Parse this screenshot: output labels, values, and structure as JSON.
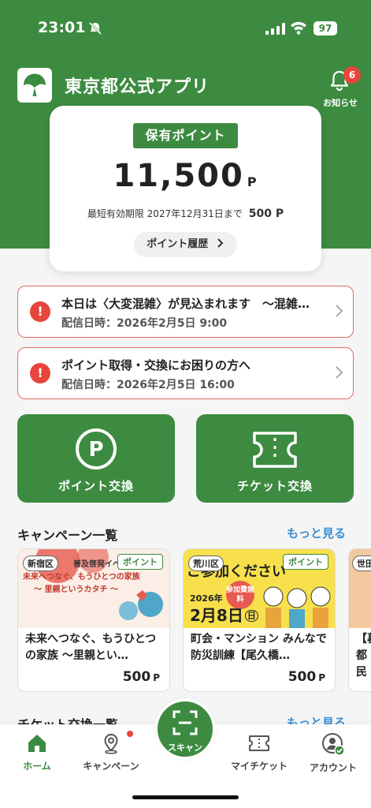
{
  "status": {
    "time": "23:01",
    "battery": "97"
  },
  "header": {
    "title": "東京都公式アプリ",
    "notice_label": "お知らせ",
    "notice_count": "6"
  },
  "points": {
    "tag": "保有ポイント",
    "value": "11,500",
    "unit": "P",
    "expiry_label": "最短有効期限 2027年12月31日まで",
    "expiry_amount": "500 P",
    "history_button": "ポイント履歴"
  },
  "alerts": [
    {
      "title": "本日は〈大変混雑〉が見込まれます　～混雑…",
      "date": "配信日時：2026年2月5日 9:00"
    },
    {
      "title": "ポイント取得・交換にお困りの方へ",
      "date": "配信日時：2026年2月5日 16:00"
    }
  ],
  "actions": {
    "point_exchange": "ポイント交換",
    "ticket_exchange": "チケット交換"
  },
  "campaigns": {
    "section_title": "キャンペーン一覧",
    "more": "もっと見る",
    "items": [
      {
        "ward": "新宿区",
        "tag": "ポイント",
        "banner_top": "普及啓発イベント",
        "banner_main": "未来へつなぐ、もうひとつの家族",
        "banner_sub": "～ 里親というカタチ ～",
        "title": "未来へつなぐ、もうひとつの家族 ～里親とい…",
        "points": "500",
        "unit": "P"
      },
      {
        "ward": "荒川区",
        "tag": "ポイント",
        "banner_main": "ご参加ください",
        "banner_badge": "参加費無料",
        "banner_year": "2026年",
        "banner_date": "2月8日",
        "banner_day": "日",
        "title": "町会・マンション みんなで防災訓練【尾久橋…",
        "points": "500",
        "unit": "P"
      },
      {
        "ward": "世田",
        "title": "【募都民"
      }
    ]
  },
  "tickets": {
    "section_title": "チケット交換一覧",
    "more": "もっと見る"
  },
  "tabs": {
    "home": "ホーム",
    "campaign": "キャンペーン",
    "scan": "スキャン",
    "my_ticket": "マイチケット",
    "account": "アカウント"
  },
  "colors": {
    "primary": "#3d8b40",
    "alert": "#e8453c",
    "link": "#3b8fd6"
  }
}
